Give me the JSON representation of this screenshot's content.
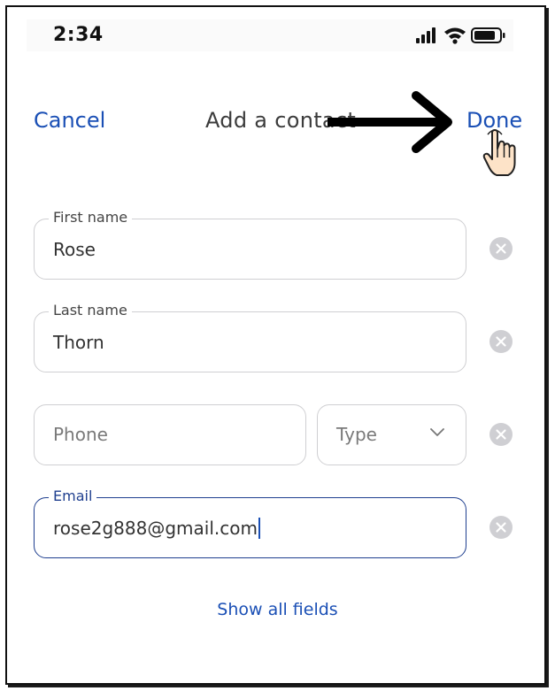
{
  "status_bar": {
    "time": "2:34"
  },
  "header": {
    "cancel_label": "Cancel",
    "title": "Add a contact",
    "done_label": "Done"
  },
  "fields": {
    "first_name": {
      "label": "First name",
      "value": "Rose"
    },
    "last_name": {
      "label": "Last name",
      "value": "Thorn"
    },
    "phone": {
      "placeholder": "Phone"
    },
    "type": {
      "placeholder": "Type"
    },
    "email": {
      "label": "Email",
      "value": "rose2g888@gmail.com"
    }
  },
  "show_all_fields_label": "Show all fields",
  "colors": {
    "accent": "#1a4fb5",
    "focus_border": "#1f3f8f",
    "clear_button": "#cfcfd3"
  },
  "icons": [
    "signal-icon",
    "wifi-icon",
    "battery-icon",
    "clear-icon",
    "chevron-down-icon",
    "arrow-annotation-icon",
    "hand-pointer-icon"
  ]
}
